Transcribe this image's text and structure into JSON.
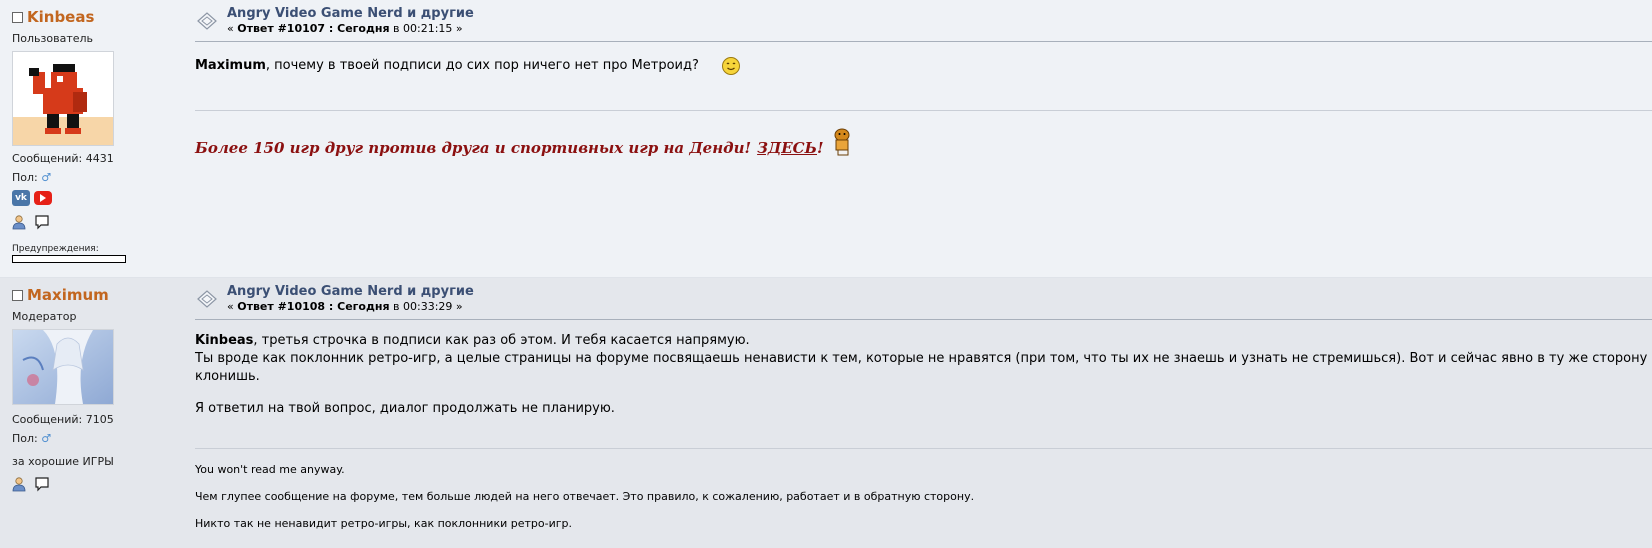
{
  "posts": [
    {
      "username": "Kinbeas",
      "rank": "Пользователь",
      "messages": "Сообщений: 4431",
      "gender_label": "Пол:",
      "gender_symbol": "♂",
      "warnings_label": "Предупреждения:",
      "warning_level": 0,
      "topic_title": "Angry Video Game Nerd и другие",
      "reply_prefix": "«",
      "reply_bold": "Ответ #10107 : Сегодня",
      "reply_rest": "в 00:21:15",
      "reply_suffix": "»",
      "body_name": "Maximum",
      "body_text": ", почему в твоей подписи до сих пор ничего нет про Метроид?",
      "signature_text": "Более 150 игр друг против друга и спортивных игр на Денди!",
      "signature_link": "ЗДЕСЬ",
      "signature_end": "!"
    },
    {
      "username": "Maximum",
      "rank": "Модератор",
      "messages": "Сообщений: 7105",
      "gender_label": "Пол:",
      "gender_symbol": "♂",
      "extra": "за хорошие ИГРЫ",
      "topic_title": "Angry Video Game Nerd и другие",
      "reply_prefix": "«",
      "reply_bold": "Ответ #10108 : Сегодня",
      "reply_rest": "в 00:33:29",
      "reply_suffix": "»",
      "body_name": "Kinbeas",
      "body_line1": ", третья строчка в подписи как раз об этом. И тебя касается напрямую.",
      "body_line2": "Ты вроде как поклонник ретро-игр, а целые страницы на форуме посвящаешь ненависти к тем, которые не нравятся (при том, что ты их не знаешь и узнать не стремишься). Вот и сейчас явно в ту же сторону клонишь.",
      "body_line3": "Я ответил на твой вопрос, диалог продолжать не планирую.",
      "sig_line1": "You won't read me anyway.",
      "sig_line2": "Чем глупее сообщение на форуме, тем больше людей на него отвечает. Это правило, к сожалению, работает и в обратную сторону.",
      "sig_line3": "Никто так не ненавидит ретро-игры, как поклонники ретро-игр."
    }
  ],
  "social": {
    "vk_text": "vk"
  },
  "colors": {
    "username": "#c2661f",
    "topic_title": "#3b4f74",
    "signature": "#8b1010"
  }
}
